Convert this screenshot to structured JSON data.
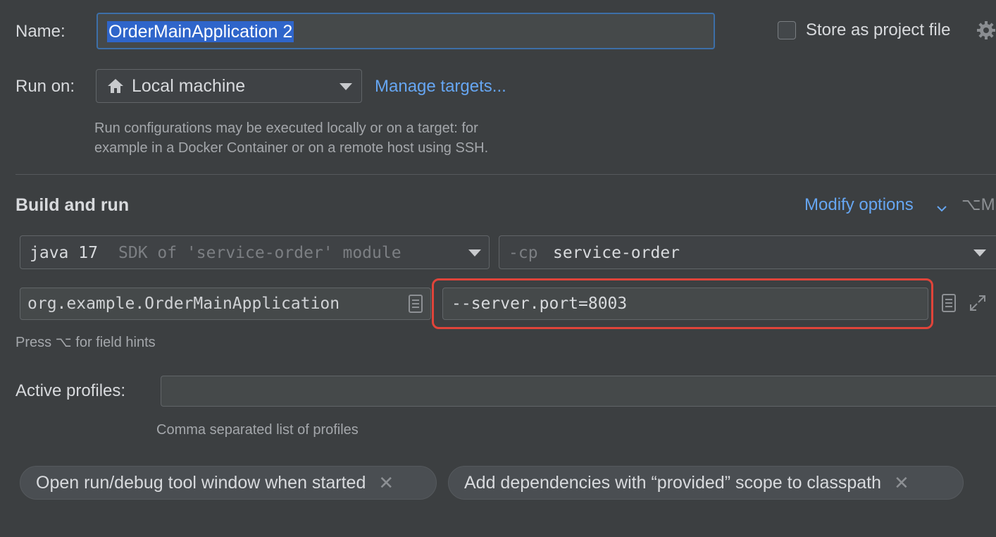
{
  "name_row": {
    "label": "Name:",
    "value": "OrderMainApplication 2",
    "store_label": "Store as project file"
  },
  "run_on": {
    "label": "Run on:",
    "target": "Local machine",
    "manage_link": "Manage targets...",
    "help_line1": "Run configurations may be executed locally or on a target: for",
    "help_line2": "example in a Docker Container or on a remote host using SSH."
  },
  "build": {
    "title": "Build and run",
    "modify_label": "Modify options",
    "modify_shortcut": "⌥M",
    "sdk_main": "java 17",
    "sdk_sub": "SDK of 'service-order' module",
    "cp_prefix": "-cp",
    "cp_value": "service-order",
    "main_class": "org.example.OrderMainApplication",
    "program_args": "--server.port=8003",
    "hint": "Press ⌥ for field hints"
  },
  "profiles": {
    "label": "Active profiles:",
    "value": "",
    "hint": "Comma separated list of profiles"
  },
  "chips": [
    {
      "label": "Open run/debug tool window when started"
    },
    {
      "label": "Add dependencies with “provided” scope to classpath"
    }
  ],
  "colors": {
    "background": "#3c3f41",
    "link": "#66a6f2",
    "highlight_box": "#e0443a",
    "selection": "#2f65ca"
  }
}
